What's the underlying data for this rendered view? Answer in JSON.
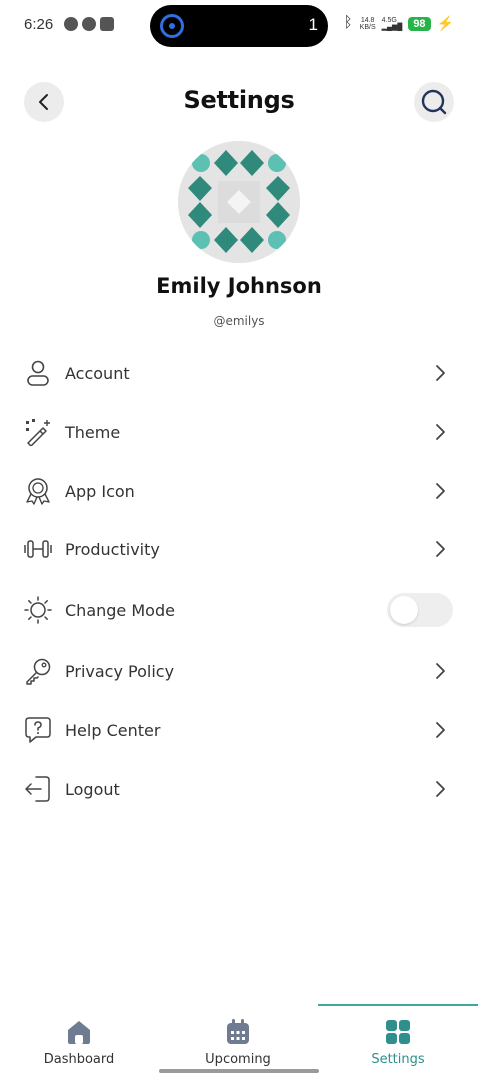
{
  "status_bar": {
    "time": "6:26",
    "island_count": "1",
    "net_speed_top": "14.8",
    "net_speed_bottom": "KB/S",
    "signal": "4.5G",
    "battery": "98"
  },
  "header": {
    "title": "Settings",
    "back_icon": "back-arrow-icon",
    "search_icon": "search-icon"
  },
  "profile": {
    "name": "Emily Johnson",
    "handle": "@emilys"
  },
  "settings": {
    "items": [
      {
        "label": "Account",
        "icon": "user-icon",
        "control": "chevron"
      },
      {
        "label": "Theme",
        "icon": "magic-wand-icon",
        "control": "chevron"
      },
      {
        "label": "App Icon",
        "icon": "award-badge-icon",
        "control": "chevron"
      },
      {
        "label": "Productivity",
        "icon": "dumbbell-icon",
        "control": "chevron"
      },
      {
        "label": "Change Mode",
        "icon": "sun-icon",
        "control": "toggle",
        "toggle_on": false
      },
      {
        "label": "Privacy Policy",
        "icon": "key-icon",
        "control": "chevron"
      },
      {
        "label": "Help Center",
        "icon": "help-bubble-icon",
        "control": "chevron"
      },
      {
        "label": "Logout",
        "icon": "logout-icon",
        "control": "chevron"
      }
    ]
  },
  "bottom_nav": {
    "items": [
      {
        "label": "Dashboard",
        "icon": "home-icon",
        "active": false
      },
      {
        "label": "Upcoming",
        "icon": "calendar-icon",
        "active": false
      },
      {
        "label": "Settings",
        "icon": "grid-icon",
        "active": true
      }
    ]
  },
  "colors": {
    "accent": "#2e8f8c",
    "avatar_dark": "#2f8a7c",
    "avatar_light": "#5cc1b3",
    "toggle_off": "#eeeeee",
    "nav_inactive_icon": "#6e7b91"
  }
}
